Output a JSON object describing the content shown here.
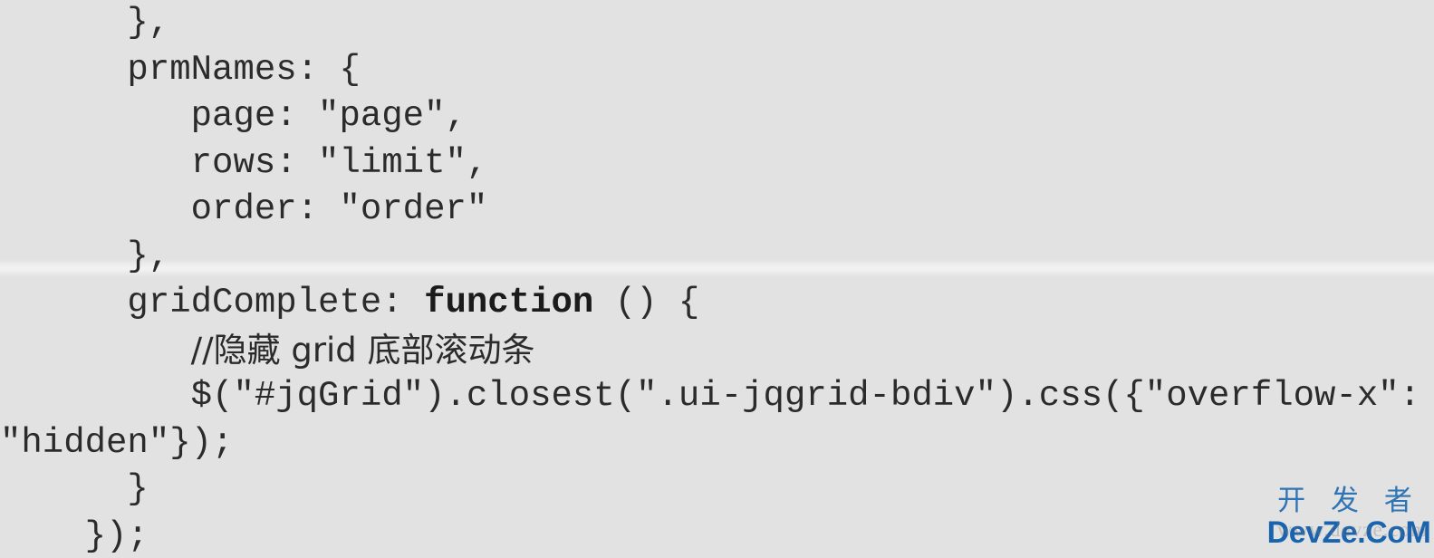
{
  "document": {
    "background_color": "#e2e2e2",
    "text_color": "#2b2b2b",
    "language": "javascript",
    "code_lines": [
      {
        "indent": 6,
        "text": "},"
      },
      {
        "indent": 6,
        "text": "prmNames: {"
      },
      {
        "indent": 9,
        "text": "page: \"page\","
      },
      {
        "indent": 9,
        "text": "rows: \"limit\","
      },
      {
        "indent": 9,
        "text": "order: \"order\""
      },
      {
        "indent": 6,
        "text": "},"
      },
      {
        "indent": 6,
        "text": "gridComplete: ",
        "keyword": "function",
        "after_keyword": " () {"
      },
      {
        "indent": 9,
        "text": "//隐藏 grid 底部滚动条",
        "cjk": true
      },
      {
        "indent": 9,
        "text": "$(\"#jqGrid\").closest(\".ui-jqgrid-bdiv\").css({\"overflow-x\":"
      },
      {
        "indent": 0,
        "text": "\"hidden\"});"
      },
      {
        "indent": 6,
        "text": "}"
      },
      {
        "indent": 4,
        "text": "});"
      }
    ]
  },
  "watermark": {
    "cjk_text": "开 发 者",
    "latin_text": "DevZe.CoM",
    "ghost_text": "www.devze.com",
    "cjk_color": "#2f74b5",
    "latin_color": "#1a63ae"
  }
}
